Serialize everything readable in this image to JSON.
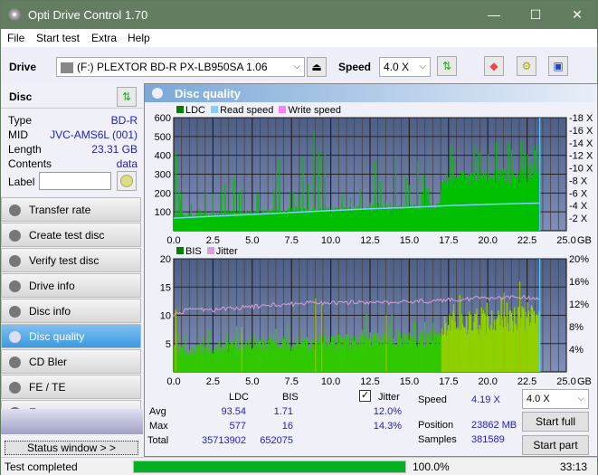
{
  "window": {
    "title": "Opti Drive Control 1.70",
    "minimize": "—",
    "maximize": "☐",
    "close": "✕"
  },
  "menu": [
    "File",
    "Start test",
    "Extra",
    "Help"
  ],
  "toolbar": {
    "drive_label": "Drive",
    "drive_value": "(F:)  PLEXTOR BD-R  PX-LB950SA 1.06",
    "speed_label": "Speed",
    "speed_value": "4.0 X",
    "icons": [
      "eject-icon",
      "refresh-icon",
      "eraser-icon",
      "settings-icon",
      "save-icon"
    ]
  },
  "disc": {
    "header": "Disc",
    "type_label": "Type",
    "type": "BD-R",
    "mid_label": "MID",
    "mid": "JVC-AMS6L (001)",
    "length_label": "Length",
    "length": "23.31 GB",
    "contents_label": "Contents",
    "contents": "data",
    "label_label": "Label",
    "label_value": ""
  },
  "nav": [
    {
      "label": "Transfer rate"
    },
    {
      "label": "Create test disc"
    },
    {
      "label": "Verify test disc"
    },
    {
      "label": "Drive info"
    },
    {
      "label": "Disc info"
    },
    {
      "label": "Disc quality",
      "active": true
    },
    {
      "label": "CD Bler"
    },
    {
      "label": "FE / TE"
    },
    {
      "label": "Extra tests"
    }
  ],
  "status_window_button": "Status window > >",
  "panel": {
    "title": "Disc quality"
  },
  "chart_data": [
    {
      "type": "area",
      "title": "LDC",
      "legend": [
        "LDC",
        "Read speed",
        "Write speed"
      ],
      "legend_colors": [
        "#008000",
        "#80d0ff",
        "#ff80ff"
      ],
      "xlabel": "GB",
      "xlim": [
        0,
        25
      ],
      "xticks": [
        "0.0",
        "2.5",
        "5.0",
        "7.5",
        "10.0",
        "12.5",
        "15.0",
        "17.5",
        "20.0",
        "22.5",
        "25.0"
      ],
      "ylim": [
        0,
        600
      ],
      "yticks": [
        "100",
        "200",
        "300",
        "400",
        "500",
        "600"
      ],
      "y2lim": [
        0,
        18
      ],
      "y2ticks": [
        "2 X",
        "4 X",
        "6 X",
        "8 X",
        "10 X",
        "12 X",
        "14 X",
        "16 X",
        "18 X"
      ],
      "ldc_base": [
        [
          0,
          80
        ],
        [
          2.5,
          85
        ],
        [
          5,
          95
        ],
        [
          7.5,
          105
        ],
        [
          10,
          110
        ],
        [
          12.5,
          120
        ],
        [
          15,
          125
        ],
        [
          16.9,
          130
        ],
        [
          17.1,
          270
        ],
        [
          20,
          280
        ],
        [
          22.5,
          300
        ],
        [
          23.31,
          320
        ]
      ],
      "ldc_spikes": [
        [
          0.1,
          410
        ],
        [
          0.4,
          170
        ],
        [
          2.0,
          200
        ],
        [
          3.0,
          200
        ],
        [
          3.8,
          280
        ],
        [
          4.3,
          230
        ],
        [
          6.5,
          320
        ],
        [
          6.7,
          380
        ],
        [
          7.4,
          200
        ],
        [
          8.2,
          390
        ],
        [
          8.9,
          530
        ],
        [
          9.2,
          420
        ],
        [
          9.6,
          410
        ],
        [
          12.8,
          370
        ],
        [
          14.1,
          400
        ],
        [
          15.5,
          370
        ],
        [
          17.6,
          450
        ],
        [
          19.5,
          420
        ],
        [
          20.5,
          470
        ],
        [
          21.3,
          470
        ],
        [
          22.1,
          480
        ],
        [
          22.9,
          450
        ],
        [
          23.3,
          440
        ]
      ],
      "read_speed": [
        [
          0,
          2.0
        ],
        [
          2.5,
          2.3
        ],
        [
          5,
          2.6
        ],
        [
          7.5,
          2.9
        ],
        [
          10,
          3.2
        ],
        [
          12.5,
          3.5
        ],
        [
          15,
          3.7
        ],
        [
          17.5,
          4.0
        ],
        [
          20,
          4.2
        ],
        [
          22.5,
          4.35
        ],
        [
          23.31,
          4.4
        ]
      ],
      "end_marker_gb": 23.31
    },
    {
      "type": "bar",
      "title": "BIS",
      "legend": [
        "BIS",
        "Jitter"
      ],
      "legend_colors": [
        "#008000",
        "#d8a0d8"
      ],
      "xlabel": "GB",
      "xlim": [
        0,
        25
      ],
      "xticks": [
        "0.0",
        "2.5",
        "5.0",
        "7.5",
        "10.0",
        "12.5",
        "15.0",
        "17.5",
        "20.0",
        "22.5",
        "25.0"
      ],
      "ylim": [
        0,
        20
      ],
      "yticks": [
        "5",
        "10",
        "15",
        "20"
      ],
      "y2lim": [
        0,
        20
      ],
      "y2ticks": [
        "4%",
        "8%",
        "12%",
        "16%",
        "20%"
      ],
      "bis_base": [
        [
          0,
          4
        ],
        [
          5,
          5
        ],
        [
          10,
          5.5
        ],
        [
          15,
          6
        ],
        [
          16.9,
          6
        ],
        [
          17.1,
          9
        ],
        [
          20,
          9.5
        ],
        [
          23.31,
          10
        ]
      ],
      "bis_spikes": [
        [
          0.1,
          11
        ],
        [
          4.3,
          8
        ],
        [
          9.0,
          13
        ],
        [
          9.4,
          12
        ],
        [
          13.5,
          10
        ],
        [
          17.8,
          12
        ],
        [
          21.0,
          14
        ],
        [
          22.0,
          16
        ]
      ],
      "jitter_pct": [
        [
          0,
          10.2
        ],
        [
          1,
          11
        ],
        [
          2.5,
          11
        ],
        [
          5,
          11.5
        ],
        [
          7.5,
          12
        ],
        [
          10,
          12.3
        ],
        [
          12.5,
          12.2
        ],
        [
          15,
          12.3
        ],
        [
          17.5,
          12.8
        ],
        [
          20,
          13
        ],
        [
          23.31,
          13.2
        ]
      ]
    }
  ],
  "stats": {
    "col_ldc": "LDC",
    "col_bis": "BIS",
    "row_avg": "Avg",
    "row_max": "Max",
    "row_total": "Total",
    "avg_ldc": "93.54",
    "avg_bis": "1.71",
    "max_ldc": "577",
    "max_bis": "16",
    "total_ldc": "35713902",
    "total_bis": "652075",
    "jitter_label": "Jitter",
    "jitter_checked": true,
    "avg_jitter": "12.0%",
    "max_jitter": "14.3%",
    "speed_label": "Speed",
    "speed": "4.19 X",
    "position_label": "Position",
    "position": "23862 MB",
    "samples_label": "Samples",
    "samples": "381589",
    "speed_select": "4.0 X",
    "start_full": "Start full",
    "start_part": "Start part"
  },
  "statusbar": {
    "text": "Test completed",
    "progress_pct": 100,
    "progress_text": "100.0%",
    "time": "33:13"
  }
}
